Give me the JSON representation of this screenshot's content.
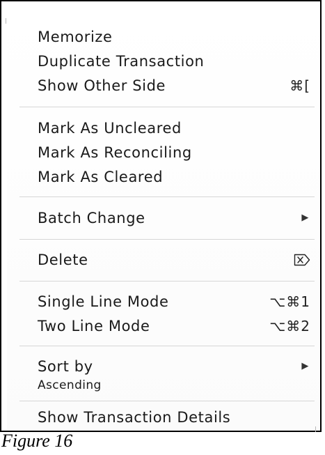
{
  "menu": {
    "group1": [
      {
        "label": "Memorize",
        "shortcut": ""
      },
      {
        "label": "Duplicate Transaction",
        "shortcut": ""
      },
      {
        "label": "Show Other Side",
        "shortcut": "⌘["
      }
    ],
    "group2": [
      {
        "label": "Mark As Uncleared"
      },
      {
        "label": "Mark As Reconciling"
      },
      {
        "label": "Mark As Cleared"
      }
    ],
    "batch_change": {
      "label": "Batch Change",
      "submenu_icon": "submenu-arrow-icon"
    },
    "delete": {
      "label": "Delete",
      "icon": "delete-key-icon"
    },
    "group5": [
      {
        "label": "Single Line Mode",
        "shortcut": "⌥⌘1"
      },
      {
        "label": "Two Line Mode",
        "shortcut": "⌥⌘2"
      }
    ],
    "sort_by": {
      "label": "Sort by",
      "sub_label": "Ascending",
      "submenu_icon": "submenu-arrow-icon"
    },
    "show_details": {
      "label": "Show Transaction Details"
    }
  },
  "caption": "Figure 16",
  "colors": {
    "frame": "#000000",
    "separator": "#d6d6d6",
    "text": "#1a1a1a"
  }
}
